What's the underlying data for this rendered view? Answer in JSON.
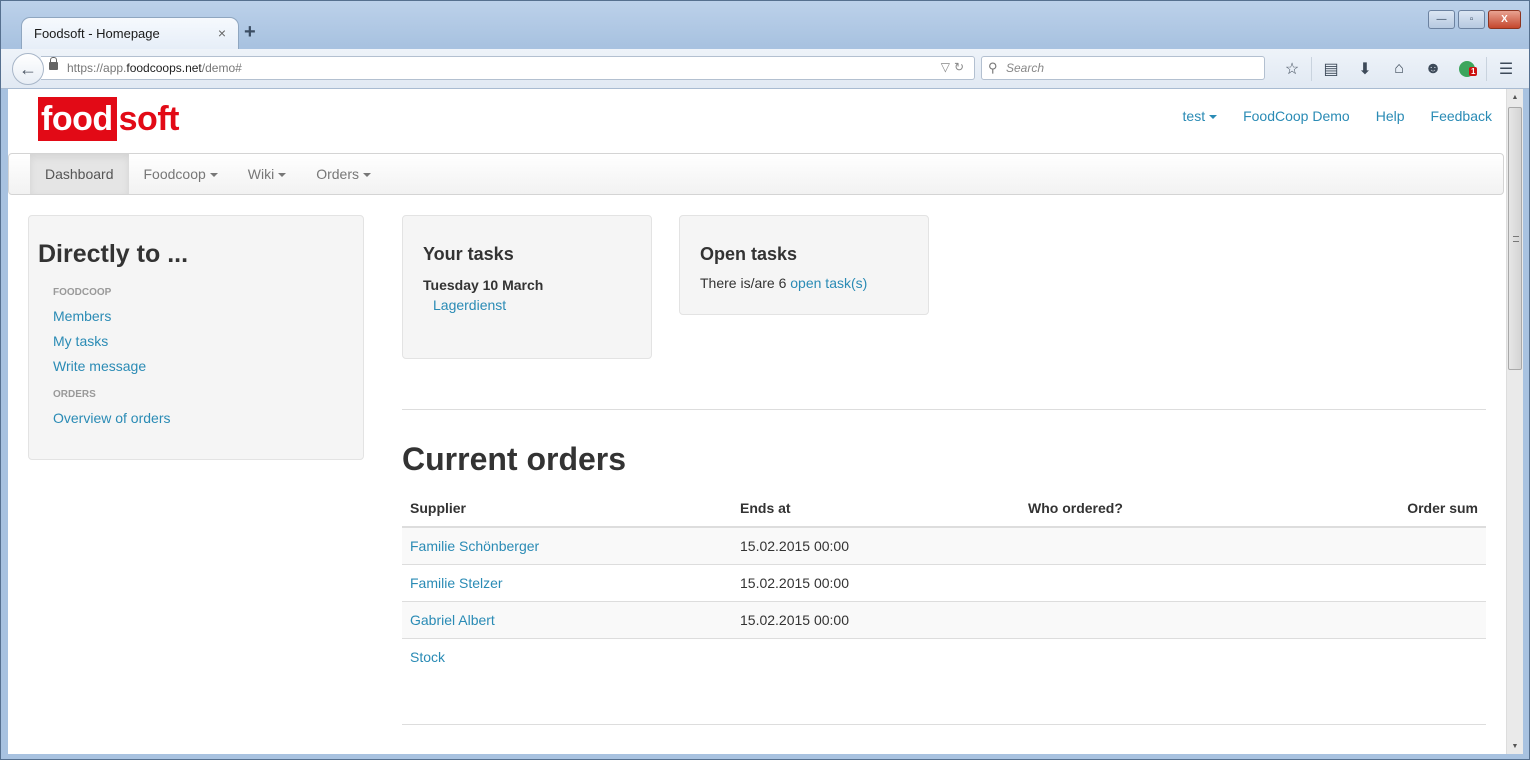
{
  "browser": {
    "tab_title": "Foodsoft - Homepage",
    "tab_close_icon": "×",
    "new_tab_icon": "+",
    "url_prefix": "https://app.",
    "url_host": "foodcoops.net",
    "url_path": "/demo#",
    "search_placeholder": "Search",
    "notification_count": "1",
    "window_buttons": {
      "minimize": "—",
      "maximize": "▫",
      "close": "X"
    }
  },
  "header": {
    "logo_part1": "food",
    "logo_part2": "soft",
    "user_menu": "test",
    "links": [
      "FoodCoop Demo",
      "Help",
      "Feedback"
    ]
  },
  "nav": {
    "items": [
      {
        "label": "Dashboard",
        "active": true,
        "dropdown": false
      },
      {
        "label": "Foodcoop",
        "active": false,
        "dropdown": true
      },
      {
        "label": "Wiki",
        "active": false,
        "dropdown": true
      },
      {
        "label": "Orders",
        "active": false,
        "dropdown": true
      }
    ]
  },
  "sidebar": {
    "title": "Directly to ...",
    "sections": [
      {
        "header": "FOODCOOP",
        "links": [
          "Members",
          "My tasks",
          "Write message"
        ]
      },
      {
        "header": "ORDERS",
        "links": [
          "Overview of orders"
        ]
      }
    ]
  },
  "your_tasks": {
    "title": "Your tasks",
    "date": "Tuesday 10 March",
    "task": "Lagerdienst"
  },
  "open_tasks": {
    "title": "Open tasks",
    "text": "There is/are 6 ",
    "link": "open task(s)"
  },
  "current_orders": {
    "title": "Current orders",
    "columns": [
      "Supplier",
      "Ends at",
      "Who ordered?",
      "Order sum"
    ],
    "rows": [
      {
        "supplier": "Familie Schönberger",
        "ends_at": "15.02.2015 00:00",
        "who": "",
        "sum": ""
      },
      {
        "supplier": "Familie Stelzer",
        "ends_at": "15.02.2015 00:00",
        "who": "",
        "sum": ""
      },
      {
        "supplier": "Gabriel Albert",
        "ends_at": "15.02.2015 00:00",
        "who": "",
        "sum": ""
      },
      {
        "supplier": "Stock",
        "ends_at": "",
        "who": "",
        "sum": ""
      }
    ]
  },
  "colors": {
    "brand_red": "#e20a16",
    "link_blue": "#2a8bb5"
  }
}
